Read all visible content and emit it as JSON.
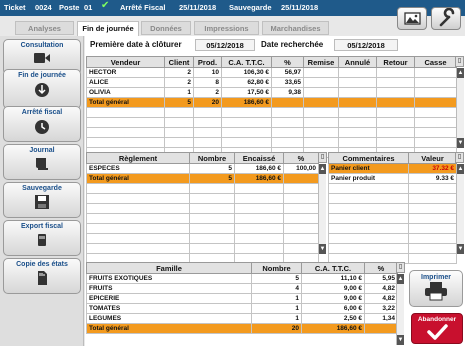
{
  "topbar": {
    "ticket_label": "Ticket",
    "ticket_number": "0024",
    "poste_label": "Poste",
    "poste_number": "01",
    "fiscal_label": "Arrêté Fiscal",
    "fiscal_date": "25/11/2018",
    "backup_label": "Sauvegarde",
    "backup_date": "25/11/2018"
  },
  "tabs": [
    {
      "label": "Analyses",
      "active": false
    },
    {
      "label": "Fin de journée",
      "active": true
    },
    {
      "label": "Données",
      "active": false
    },
    {
      "label": "Impressions",
      "active": false
    },
    {
      "label": "Marchandises",
      "active": false
    }
  ],
  "sidebar": {
    "items": [
      {
        "label": "Consultation",
        "icon": "video-camera-icon"
      },
      {
        "label": "Fin de journée",
        "icon": "day-end-icon"
      },
      {
        "label": "Arrêté fiscal",
        "icon": "fiscal-close-icon"
      },
      {
        "label": "Journal",
        "icon": "journal-icon"
      },
      {
        "label": "Sauvegarde",
        "icon": "save-disk-icon"
      },
      {
        "label": "Export fiscal",
        "icon": "export-icon"
      },
      {
        "label": "Copie des états",
        "icon": "copy-sd-card-icon"
      }
    ]
  },
  "header": {
    "first_date_label": "Première date à clôturer",
    "first_date": "05/12/2018",
    "search_date_label": "Date recherchée",
    "search_date": "05/12/2018"
  },
  "sales_table": {
    "columns": [
      "Vendeur",
      "Client",
      "Prod.",
      "C.A. T.T.C.",
      "%",
      "Remise",
      "Annulé",
      "Retour",
      "Casse"
    ],
    "rows": [
      [
        "HECTOR",
        "2",
        "10",
        "106,30 €",
        "56,97",
        "",
        "",
        "",
        ""
      ],
      [
        "ALICE",
        "2",
        "8",
        "62,80 €",
        "33,65",
        "",
        "",
        "",
        ""
      ],
      [
        "OLIVIA",
        "1",
        "2",
        "17,50 €",
        "9,38",
        "",
        "",
        "",
        ""
      ]
    ],
    "total": [
      "Total général",
      "5",
      "20",
      "186,60 €",
      "",
      "",
      "",
      "",
      ""
    ]
  },
  "payment_table": {
    "columns": [
      "Règlement",
      "Nombre",
      "Encaissé",
      "%"
    ],
    "rows": [
      [
        "ESPECES",
        "5",
        "186,60 €",
        "100,00"
      ]
    ],
    "total": [
      "Total général",
      "5",
      "186,60 €",
      ""
    ]
  },
  "comments_table": {
    "columns": [
      "Commentaires",
      "Valeur"
    ],
    "rows": [
      {
        "label": "Panier client",
        "value": "37.32 €",
        "highlight": true
      },
      {
        "label": "Panier produit",
        "value": "9.33 €",
        "highlight": false
      }
    ]
  },
  "family_table": {
    "columns": [
      "Famille",
      "Nombre",
      "C.A. T.T.C.",
      "%"
    ],
    "rows": [
      [
        "FRUITS EXOTIQUES",
        "5",
        "11,10 €",
        "5,95"
      ],
      [
        "FRUITS",
        "4",
        "9,00 €",
        "4,82"
      ],
      [
        "EPICERIE",
        "1",
        "9,00 €",
        "4,82"
      ],
      [
        "TOMATES",
        "1",
        "6,00 €",
        "3,22"
      ],
      [
        "LEGUMES",
        "1",
        "2,50 €",
        "1,34"
      ]
    ],
    "total": [
      "Total général",
      "20",
      "186,60 €",
      ""
    ]
  },
  "buttons": {
    "print_label": "Imprimer",
    "cancel_label": "Abandonner"
  },
  "colors": {
    "topbar": "#1f5a8a",
    "total_row": "#f39a1e",
    "cancel": "#c8102e",
    "label_blue": "#1a4f8a"
  }
}
